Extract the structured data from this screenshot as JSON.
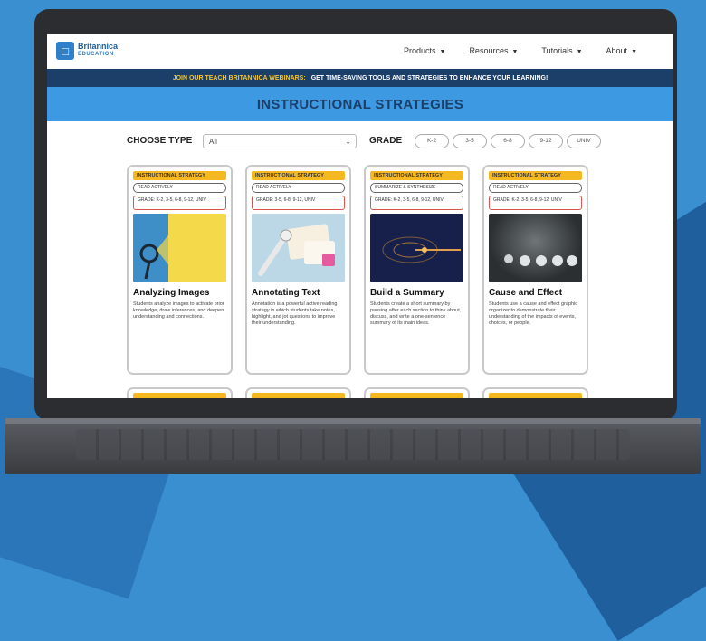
{
  "site": {
    "brand_name": "Britannica",
    "brand_sub": "EDUCATION",
    "nav": [
      "Products",
      "Resources",
      "Tutorials",
      "About"
    ]
  },
  "banner": {
    "highlight": "JOIN OUR TEACH BRITANNICA WEBINARS:",
    "text": "GET TIME-SAVING TOOLS AND STRATEGIES TO ENHANCE YOUR LEARNING!"
  },
  "page_title": "INSTRUCTIONAL STRATEGIES",
  "filters": {
    "type_label": "CHOOSE TYPE",
    "type_value": "All",
    "grade_label": "GRADE",
    "grade_options": [
      "K-2",
      "3-5",
      "6-8",
      "9-12",
      "UNIV"
    ]
  },
  "cards": [
    {
      "category": "INSTRUCTIONAL STRATEGY",
      "activity": "READ ACTIVELY",
      "grades": "GRADE: K-2, 3-5, 6-8, 9-12, UNIV",
      "title": "Analyzing Images",
      "description": "Students analyze images to activate prior knowledge, draw inferences, and deepen understanding and connections."
    },
    {
      "category": "INSTRUCTIONAL STRATEGY",
      "activity": "READ ACTIVELY",
      "grades": "GRADE: 3-5, 6-8, 9-12, UNIV",
      "title": "Annotating Text",
      "description": "Annotation is a powerful active reading strategy in which students take notes, highlight, and jot questions to improve their understanding."
    },
    {
      "category": "INSTRUCTIONAL STRATEGY",
      "activity": "SUMMARIZE & SYNTHESIZE",
      "grades": "GRADE: K-2, 3-5, 6-8, 9-12, UNIV",
      "title": "Build a Summary",
      "description": "Students create a short summary by pausing after each section to think about, discuss, and write a one-sentence summary of its main ideas."
    },
    {
      "category": "INSTRUCTIONAL STRATEGY",
      "activity": "READ ACTIVELY",
      "grades": "GRADE: K-2, 3-5, 6-8, 9-12, UNIV",
      "title": "Cause and Effect",
      "description": "Students use a cause and effect graphic organizer to demonstrate their understanding of the impacts of events, choices, or people."
    }
  ]
}
